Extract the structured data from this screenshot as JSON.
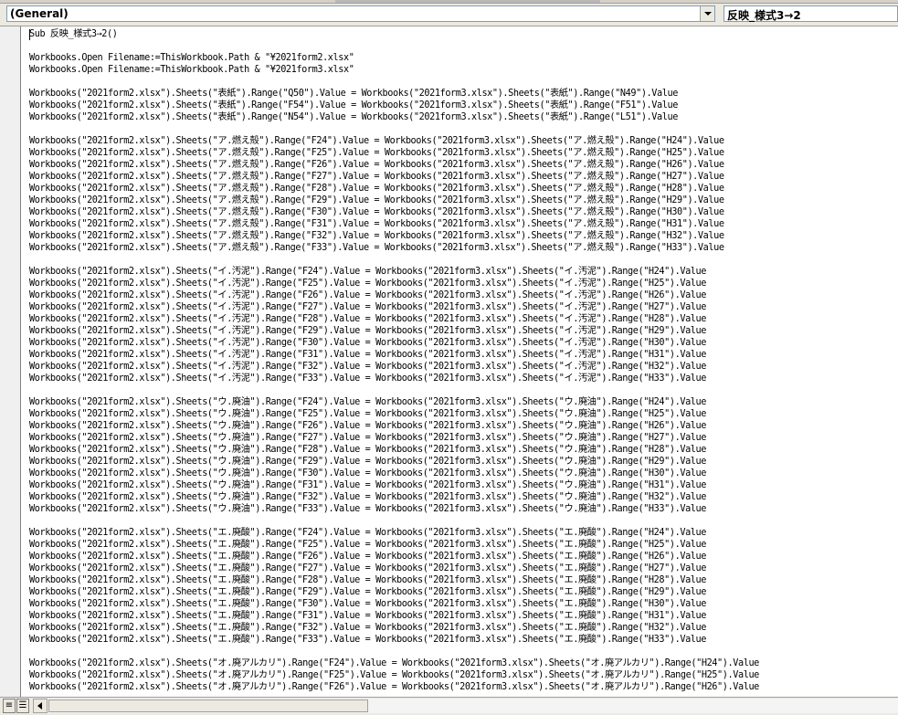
{
  "header": {
    "object_combo": "(General)",
    "procedure_combo": "反映_様式3→2"
  },
  "code_lines": [
    "Sub 反映_様式3→2()",
    "",
    "Workbooks.Open Filename:=ThisWorkbook.Path & \"¥2021form2.xlsx\"",
    "Workbooks.Open Filename:=ThisWorkbook.Path & \"¥2021form3.xlsx\"",
    "",
    "Workbooks(\"2021form2.xlsx\").Sheets(\"表紙\").Range(\"Q50\").Value = Workbooks(\"2021form3.xlsx\").Sheets(\"表紙\").Range(\"N49\").Value",
    "Workbooks(\"2021form2.xlsx\").Sheets(\"表紙\").Range(\"F54\").Value = Workbooks(\"2021form3.xlsx\").Sheets(\"表紙\").Range(\"F51\").Value",
    "Workbooks(\"2021form2.xlsx\").Sheets(\"表紙\").Range(\"N54\").Value = Workbooks(\"2021form3.xlsx\").Sheets(\"表紙\").Range(\"L51\").Value",
    "",
    "Workbooks(\"2021form2.xlsx\").Sheets(\"ア.燃え殻\").Range(\"F24\").Value = Workbooks(\"2021form3.xlsx\").Sheets(\"ア.燃え殻\").Range(\"H24\").Value",
    "Workbooks(\"2021form2.xlsx\").Sheets(\"ア.燃え殻\").Range(\"F25\").Value = Workbooks(\"2021form3.xlsx\").Sheets(\"ア.燃え殻\").Range(\"H25\").Value",
    "Workbooks(\"2021form2.xlsx\").Sheets(\"ア.燃え殻\").Range(\"F26\").Value = Workbooks(\"2021form3.xlsx\").Sheets(\"ア.燃え殻\").Range(\"H26\").Value",
    "Workbooks(\"2021form2.xlsx\").Sheets(\"ア.燃え殻\").Range(\"F27\").Value = Workbooks(\"2021form3.xlsx\").Sheets(\"ア.燃え殻\").Range(\"H27\").Value",
    "Workbooks(\"2021form2.xlsx\").Sheets(\"ア.燃え殻\").Range(\"F28\").Value = Workbooks(\"2021form3.xlsx\").Sheets(\"ア.燃え殻\").Range(\"H28\").Value",
    "Workbooks(\"2021form2.xlsx\").Sheets(\"ア.燃え殻\").Range(\"F29\").Value = Workbooks(\"2021form3.xlsx\").Sheets(\"ア.燃え殻\").Range(\"H29\").Value",
    "Workbooks(\"2021form2.xlsx\").Sheets(\"ア.燃え殻\").Range(\"F30\").Value = Workbooks(\"2021form3.xlsx\").Sheets(\"ア.燃え殻\").Range(\"H30\").Value",
    "Workbooks(\"2021form2.xlsx\").Sheets(\"ア.燃え殻\").Range(\"F31\").Value = Workbooks(\"2021form3.xlsx\").Sheets(\"ア.燃え殻\").Range(\"H31\").Value",
    "Workbooks(\"2021form2.xlsx\").Sheets(\"ア.燃え殻\").Range(\"F32\").Value = Workbooks(\"2021form3.xlsx\").Sheets(\"ア.燃え殻\").Range(\"H32\").Value",
    "Workbooks(\"2021form2.xlsx\").Sheets(\"ア.燃え殻\").Range(\"F33\").Value = Workbooks(\"2021form3.xlsx\").Sheets(\"ア.燃え殻\").Range(\"H33\").Value",
    "",
    "Workbooks(\"2021form2.xlsx\").Sheets(\"イ.汚泥\").Range(\"F24\").Value = Workbooks(\"2021form3.xlsx\").Sheets(\"イ.汚泥\").Range(\"H24\").Value",
    "Workbooks(\"2021form2.xlsx\").Sheets(\"イ.汚泥\").Range(\"F25\").Value = Workbooks(\"2021form3.xlsx\").Sheets(\"イ.汚泥\").Range(\"H25\").Value",
    "Workbooks(\"2021form2.xlsx\").Sheets(\"イ.汚泥\").Range(\"F26\").Value = Workbooks(\"2021form3.xlsx\").Sheets(\"イ.汚泥\").Range(\"H26\").Value",
    "Workbooks(\"2021form2.xlsx\").Sheets(\"イ.汚泥\").Range(\"F27\").Value = Workbooks(\"2021form3.xlsx\").Sheets(\"イ.汚泥\").Range(\"H27\").Value",
    "Workbooks(\"2021form2.xlsx\").Sheets(\"イ.汚泥\").Range(\"F28\").Value = Workbooks(\"2021form3.xlsx\").Sheets(\"イ.汚泥\").Range(\"H28\").Value",
    "Workbooks(\"2021form2.xlsx\").Sheets(\"イ.汚泥\").Range(\"F29\").Value = Workbooks(\"2021form3.xlsx\").Sheets(\"イ.汚泥\").Range(\"H29\").Value",
    "Workbooks(\"2021form2.xlsx\").Sheets(\"イ.汚泥\").Range(\"F30\").Value = Workbooks(\"2021form3.xlsx\").Sheets(\"イ.汚泥\").Range(\"H30\").Value",
    "Workbooks(\"2021form2.xlsx\").Sheets(\"イ.汚泥\").Range(\"F31\").Value = Workbooks(\"2021form3.xlsx\").Sheets(\"イ.汚泥\").Range(\"H31\").Value",
    "Workbooks(\"2021form2.xlsx\").Sheets(\"イ.汚泥\").Range(\"F32\").Value = Workbooks(\"2021form3.xlsx\").Sheets(\"イ.汚泥\").Range(\"H32\").Value",
    "Workbooks(\"2021form2.xlsx\").Sheets(\"イ.汚泥\").Range(\"F33\").Value = Workbooks(\"2021form3.xlsx\").Sheets(\"イ.汚泥\").Range(\"H33\").Value",
    "",
    "Workbooks(\"2021form2.xlsx\").Sheets(\"ウ.廃油\").Range(\"F24\").Value = Workbooks(\"2021form3.xlsx\").Sheets(\"ウ.廃油\").Range(\"H24\").Value",
    "Workbooks(\"2021form2.xlsx\").Sheets(\"ウ.廃油\").Range(\"F25\").Value = Workbooks(\"2021form3.xlsx\").Sheets(\"ウ.廃油\").Range(\"H25\").Value",
    "Workbooks(\"2021form2.xlsx\").Sheets(\"ウ.廃油\").Range(\"F26\").Value = Workbooks(\"2021form3.xlsx\").Sheets(\"ウ.廃油\").Range(\"H26\").Value",
    "Workbooks(\"2021form2.xlsx\").Sheets(\"ウ.廃油\").Range(\"F27\").Value = Workbooks(\"2021form3.xlsx\").Sheets(\"ウ.廃油\").Range(\"H27\").Value",
    "Workbooks(\"2021form2.xlsx\").Sheets(\"ウ.廃油\").Range(\"F28\").Value = Workbooks(\"2021form3.xlsx\").Sheets(\"ウ.廃油\").Range(\"H28\").Value",
    "Workbooks(\"2021form2.xlsx\").Sheets(\"ウ.廃油\").Range(\"F29\").Value = Workbooks(\"2021form3.xlsx\").Sheets(\"ウ.廃油\").Range(\"H29\").Value",
    "Workbooks(\"2021form2.xlsx\").Sheets(\"ウ.廃油\").Range(\"F30\").Value = Workbooks(\"2021form3.xlsx\").Sheets(\"ウ.廃油\").Range(\"H30\").Value",
    "Workbooks(\"2021form2.xlsx\").Sheets(\"ウ.廃油\").Range(\"F31\").Value = Workbooks(\"2021form3.xlsx\").Sheets(\"ウ.廃油\").Range(\"H31\").Value",
    "Workbooks(\"2021form2.xlsx\").Sheets(\"ウ.廃油\").Range(\"F32\").Value = Workbooks(\"2021form3.xlsx\").Sheets(\"ウ.廃油\").Range(\"H32\").Value",
    "Workbooks(\"2021form2.xlsx\").Sheets(\"ウ.廃油\").Range(\"F33\").Value = Workbooks(\"2021form3.xlsx\").Sheets(\"ウ.廃油\").Range(\"H33\").Value",
    "",
    "Workbooks(\"2021form2.xlsx\").Sheets(\"エ.廃酸\").Range(\"F24\").Value = Workbooks(\"2021form3.xlsx\").Sheets(\"エ.廃酸\").Range(\"H24\").Value",
    "Workbooks(\"2021form2.xlsx\").Sheets(\"エ.廃酸\").Range(\"F25\").Value = Workbooks(\"2021form3.xlsx\").Sheets(\"エ.廃酸\").Range(\"H25\").Value",
    "Workbooks(\"2021form2.xlsx\").Sheets(\"エ.廃酸\").Range(\"F26\").Value = Workbooks(\"2021form3.xlsx\").Sheets(\"エ.廃酸\").Range(\"H26\").Value",
    "Workbooks(\"2021form2.xlsx\").Sheets(\"エ.廃酸\").Range(\"F27\").Value = Workbooks(\"2021form3.xlsx\").Sheets(\"エ.廃酸\").Range(\"H27\").Value",
    "Workbooks(\"2021form2.xlsx\").Sheets(\"エ.廃酸\").Range(\"F28\").Value = Workbooks(\"2021form3.xlsx\").Sheets(\"エ.廃酸\").Range(\"H28\").Value",
    "Workbooks(\"2021form2.xlsx\").Sheets(\"エ.廃酸\").Range(\"F29\").Value = Workbooks(\"2021form3.xlsx\").Sheets(\"エ.廃酸\").Range(\"H29\").Value",
    "Workbooks(\"2021form2.xlsx\").Sheets(\"エ.廃酸\").Range(\"F30\").Value = Workbooks(\"2021form3.xlsx\").Sheets(\"エ.廃酸\").Range(\"H30\").Value",
    "Workbooks(\"2021form2.xlsx\").Sheets(\"エ.廃酸\").Range(\"F31\").Value = Workbooks(\"2021form3.xlsx\").Sheets(\"エ.廃酸\").Range(\"H31\").Value",
    "Workbooks(\"2021form2.xlsx\").Sheets(\"エ.廃酸\").Range(\"F32\").Value = Workbooks(\"2021form3.xlsx\").Sheets(\"エ.廃酸\").Range(\"H32\").Value",
    "Workbooks(\"2021form2.xlsx\").Sheets(\"エ.廃酸\").Range(\"F33\").Value = Workbooks(\"2021form3.xlsx\").Sheets(\"エ.廃酸\").Range(\"H33\").Value",
    "",
    "Workbooks(\"2021form2.xlsx\").Sheets(\"オ.廃アルカリ\").Range(\"F24\").Value = Workbooks(\"2021form3.xlsx\").Sheets(\"オ.廃アルカリ\").Range(\"H24\").Value",
    "Workbooks(\"2021form2.xlsx\").Sheets(\"オ.廃アルカリ\").Range(\"F25\").Value = Workbooks(\"2021form3.xlsx\").Sheets(\"オ.廃アルカリ\").Range(\"H25\").Value",
    "Workbooks(\"2021form2.xlsx\").Sheets(\"オ.廃アルカリ\").Range(\"F26\").Value = Workbooks(\"2021form3.xlsx\").Sheets(\"オ.廃アルカリ\").Range(\"H26\").Value"
  ],
  "footer": {
    "procedure_view_icon": "procedure-view-icon",
    "full_module_view_icon": "full-module-view-icon"
  }
}
